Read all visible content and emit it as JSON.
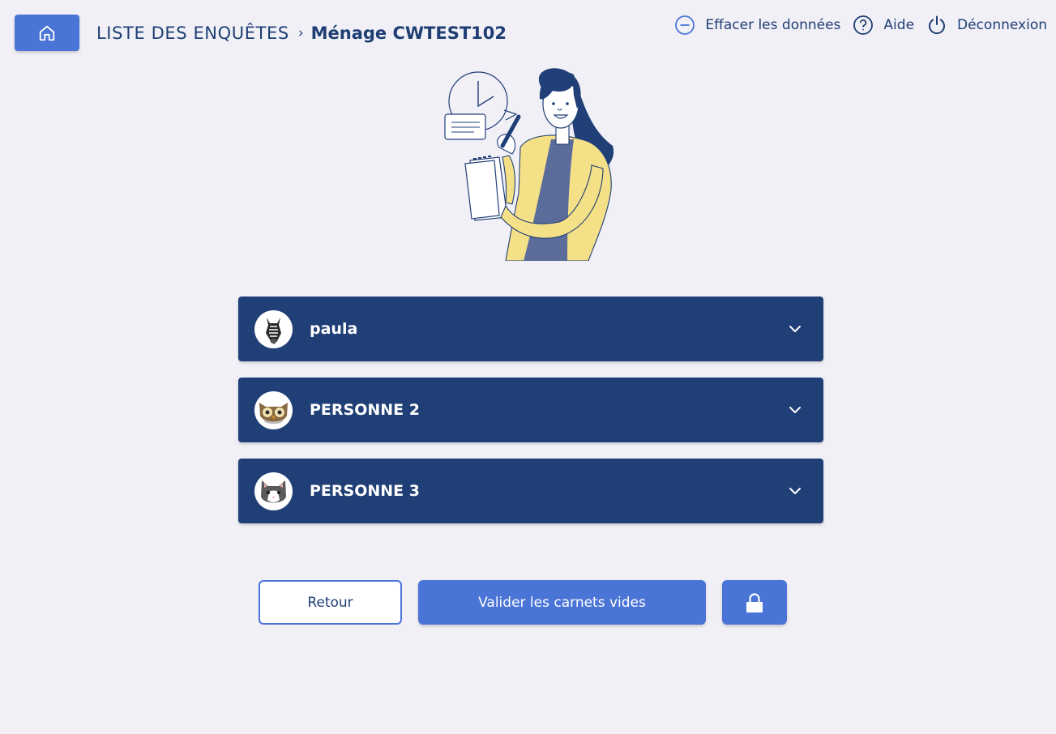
{
  "header": {
    "home_icon": "home-icon",
    "breadcrumb": {
      "root": "LISTE DES ENQUÊTES",
      "separator": "›",
      "current": "Ménage CWTEST102"
    },
    "actions": [
      {
        "label": "Effacer les données",
        "icon": "minus-circle-icon"
      },
      {
        "label": "Aide",
        "icon": "question-circle-icon"
      },
      {
        "label": "Déconnexion",
        "icon": "power-icon"
      }
    ]
  },
  "persons": [
    {
      "name": "paula",
      "avatar": "zebra-icon"
    },
    {
      "name": "PERSONNE 2",
      "avatar": "owl-icon"
    },
    {
      "name": "PERSONNE 3",
      "avatar": "cat-icon"
    }
  ],
  "footer": {
    "back_label": "Retour",
    "validate_label": "Valider les carnets vides",
    "lock_icon": "lock-icon"
  },
  "colors": {
    "background": "#f1f0f7",
    "primary_blue": "#4a74d6",
    "navy": "#203f77",
    "text": "#1f3e73",
    "illustration_yellow": "#f4e086"
  }
}
